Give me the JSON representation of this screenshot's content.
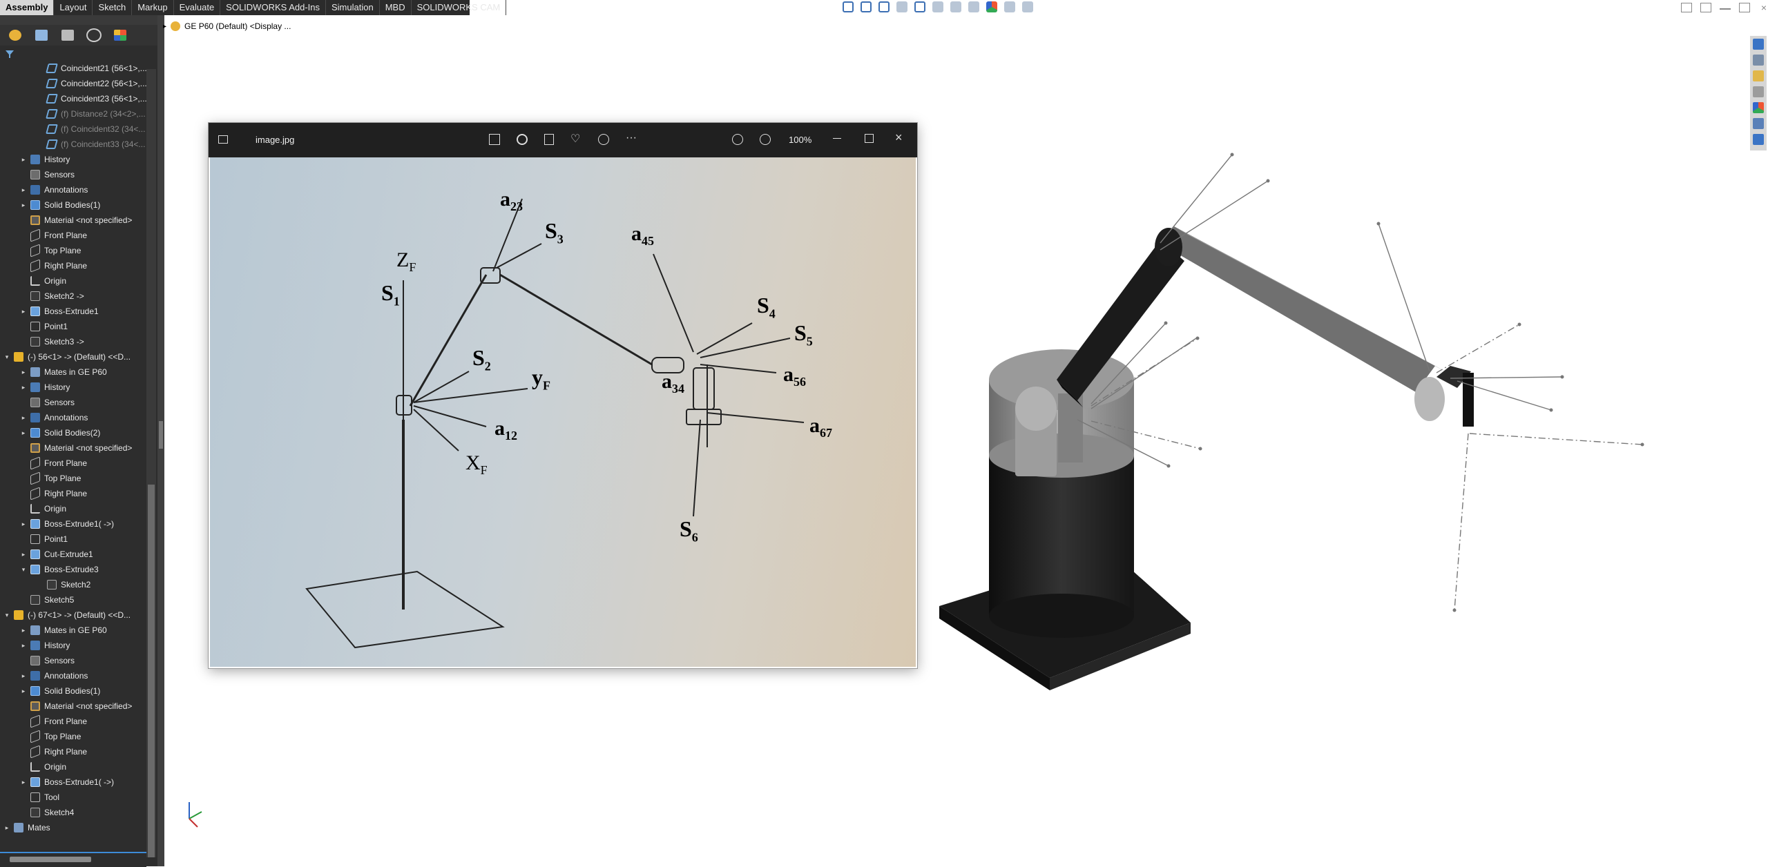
{
  "command_tabs": [
    "Assembly",
    "Layout",
    "Sketch",
    "Markup",
    "Evaluate",
    "SOLIDWORKS Add-Ins",
    "Simulation",
    "MBD",
    "SOLIDWORKS CAM"
  ],
  "active_tab": "Assembly",
  "breadcrumb": {
    "arrow": "▸",
    "label": "GE P60 (Default) <Display ..."
  },
  "tree": [
    {
      "indent": 4,
      "arrow": "",
      "icon": "mate",
      "label": "Coincident21 (56<1>,...",
      "dim": false
    },
    {
      "indent": 4,
      "arrow": "",
      "icon": "mate",
      "label": "Coincident22 (56<1>,...",
      "dim": false
    },
    {
      "indent": 4,
      "arrow": "",
      "icon": "mate",
      "label": "Coincident23 (56<1>,...",
      "dim": false
    },
    {
      "indent": 4,
      "arrow": "",
      "icon": "mate",
      "label": "(f) Distance2 (34<2>,...",
      "dim": true
    },
    {
      "indent": 4,
      "arrow": "",
      "icon": "mate",
      "label": "(f) Coincident32 (34<...",
      "dim": true
    },
    {
      "indent": 4,
      "arrow": "",
      "icon": "mate",
      "label": "(f) Coincident33 (34<...",
      "dim": true
    },
    {
      "indent": 2,
      "arrow": "▸",
      "icon": "hist",
      "label": "History",
      "dim": false
    },
    {
      "indent": 2,
      "arrow": "",
      "icon": "sens",
      "label": "Sensors",
      "dim": false
    },
    {
      "indent": 2,
      "arrow": "▸",
      "icon": "ann",
      "label": "Annotations",
      "dim": false
    },
    {
      "indent": 2,
      "arrow": "▸",
      "icon": "bodies",
      "label": "Solid Bodies(1)",
      "dim": false
    },
    {
      "indent": 2,
      "arrow": "",
      "icon": "mat",
      "label": "Material <not specified>",
      "dim": false
    },
    {
      "indent": 2,
      "arrow": "",
      "icon": "plane",
      "label": "Front Plane",
      "dim": false
    },
    {
      "indent": 2,
      "arrow": "",
      "icon": "plane",
      "label": "Top Plane",
      "dim": false
    },
    {
      "indent": 2,
      "arrow": "",
      "icon": "plane",
      "label": "Right Plane",
      "dim": false
    },
    {
      "indent": 2,
      "arrow": "",
      "icon": "origin",
      "label": "Origin",
      "dim": false
    },
    {
      "indent": 2,
      "arrow": "",
      "icon": "sketch",
      "label": "Sketch2 ->",
      "dim": false
    },
    {
      "indent": 2,
      "arrow": "▸",
      "icon": "feat",
      "label": "Boss-Extrude1",
      "dim": false
    },
    {
      "indent": 2,
      "arrow": "",
      "icon": "point",
      "label": "Point1",
      "dim": false
    },
    {
      "indent": 2,
      "arrow": "",
      "icon": "sketch",
      "label": "Sketch3 ->",
      "dim": false
    },
    {
      "indent": 0,
      "arrow": "▾",
      "icon": "comp",
      "label": "(-) 56<1> -> (Default) <<D...",
      "dim": false
    },
    {
      "indent": 2,
      "arrow": "▸",
      "icon": "folder",
      "label": "Mates in GE P60",
      "dim": false
    },
    {
      "indent": 2,
      "arrow": "▸",
      "icon": "hist",
      "label": "History",
      "dim": false
    },
    {
      "indent": 2,
      "arrow": "",
      "icon": "sens",
      "label": "Sensors",
      "dim": false
    },
    {
      "indent": 2,
      "arrow": "▸",
      "icon": "ann",
      "label": "Annotations",
      "dim": false
    },
    {
      "indent": 2,
      "arrow": "▸",
      "icon": "bodies",
      "label": "Solid Bodies(2)",
      "dim": false
    },
    {
      "indent": 2,
      "arrow": "",
      "icon": "mat",
      "label": "Material <not specified>",
      "dim": false
    },
    {
      "indent": 2,
      "arrow": "",
      "icon": "plane",
      "label": "Front Plane",
      "dim": false
    },
    {
      "indent": 2,
      "arrow": "",
      "icon": "plane",
      "label": "Top Plane",
      "dim": false
    },
    {
      "indent": 2,
      "arrow": "",
      "icon": "plane",
      "label": "Right Plane",
      "dim": false
    },
    {
      "indent": 2,
      "arrow": "",
      "icon": "origin",
      "label": "Origin",
      "dim": false
    },
    {
      "indent": 2,
      "arrow": "▸",
      "icon": "feat",
      "label": "Boss-Extrude1( ->)",
      "dim": false
    },
    {
      "indent": 2,
      "arrow": "",
      "icon": "point",
      "label": "Point1",
      "dim": false
    },
    {
      "indent": 2,
      "arrow": "▸",
      "icon": "feat",
      "label": "Cut-Extrude1",
      "dim": false
    },
    {
      "indent": 2,
      "arrow": "▾",
      "icon": "feat",
      "label": "Boss-Extrude3",
      "dim": false
    },
    {
      "indent": 4,
      "arrow": "",
      "icon": "sketch",
      "label": "Sketch2",
      "dim": false
    },
    {
      "indent": 2,
      "arrow": "",
      "icon": "sketch",
      "label": "Sketch5",
      "dim": false
    },
    {
      "indent": 0,
      "arrow": "▾",
      "icon": "comp",
      "label": "(-) 67<1> -> (Default) <<D...",
      "dim": false
    },
    {
      "indent": 2,
      "arrow": "▸",
      "icon": "folder",
      "label": "Mates in GE P60",
      "dim": false
    },
    {
      "indent": 2,
      "arrow": "▸",
      "icon": "hist",
      "label": "History",
      "dim": false
    },
    {
      "indent": 2,
      "arrow": "",
      "icon": "sens",
      "label": "Sensors",
      "dim": false
    },
    {
      "indent": 2,
      "arrow": "▸",
      "icon": "ann",
      "label": "Annotations",
      "dim": false
    },
    {
      "indent": 2,
      "arrow": "▸",
      "icon": "bodies",
      "label": "Solid Bodies(1)",
      "dim": false
    },
    {
      "indent": 2,
      "arrow": "",
      "icon": "mat",
      "label": "Material <not specified>",
      "dim": false
    },
    {
      "indent": 2,
      "arrow": "",
      "icon": "plane",
      "label": "Front Plane",
      "dim": false
    },
    {
      "indent": 2,
      "arrow": "",
      "icon": "plane",
      "label": "Top Plane",
      "dim": false
    },
    {
      "indent": 2,
      "arrow": "",
      "icon": "plane",
      "label": "Right Plane",
      "dim": false
    },
    {
      "indent": 2,
      "arrow": "",
      "icon": "origin",
      "label": "Origin",
      "dim": false
    },
    {
      "indent": 2,
      "arrow": "▸",
      "icon": "feat",
      "label": "Boss-Extrude1( ->)",
      "dim": false
    },
    {
      "indent": 2,
      "arrow": "",
      "icon": "point",
      "label": "Tool",
      "dim": false
    },
    {
      "indent": 2,
      "arrow": "",
      "icon": "sketch",
      "label": "Sketch4",
      "dim": false
    },
    {
      "indent": 0,
      "arrow": "▸",
      "icon": "folder",
      "label": "Mates",
      "dim": false
    }
  ],
  "viewer": {
    "filename": "image.jpg",
    "zoom": "100%",
    "labels": {
      "a23": "a",
      "a23_sub": "23",
      "s3": "S",
      "s3_sub": "3",
      "a45": "a",
      "a45_sub": "45",
      "zf": "Z",
      "zf_sub": "F",
      "s1": "S",
      "s1_sub": "1",
      "s4": "S",
      "s4_sub": "4",
      "s5": "S",
      "s5_sub": "5",
      "s2": "S",
      "s2_sub": "2",
      "yf": "y",
      "yf_sub": "F",
      "a56": "a",
      "a56_sub": "56",
      "a34": "a",
      "a34_sub": "34",
      "a12": "a",
      "a12_sub": "12",
      "a67": "a",
      "a67_sub": "67",
      "xf": "X",
      "xf_sub": "F",
      "s6": "S",
      "s6_sub": "6"
    }
  },
  "colors": {
    "accent": "#3d8bd8",
    "panel": "#2d2d2d",
    "viewer_bar": "#202020"
  }
}
